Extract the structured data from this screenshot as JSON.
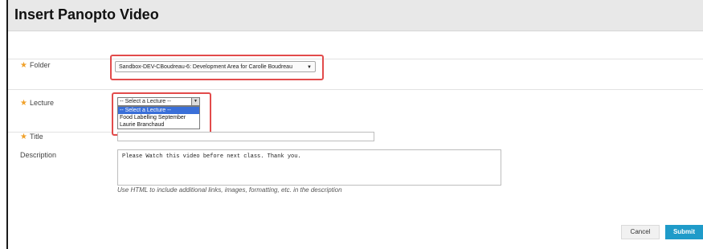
{
  "dialog": {
    "title": "Insert Panopto Video"
  },
  "form": {
    "folder": {
      "label": "Folder",
      "value": "Sandbox-DEV-CBoudreau-6: Development Area for Carolle Boudreau"
    },
    "lecture": {
      "label": "Lecture",
      "selected": "-- Select a Lecture --",
      "options": [
        "-- Select a Lecture --",
        "Food Labelling September",
        "Laurie Branchaud"
      ]
    },
    "title": {
      "label": "Title",
      "value": ""
    },
    "description": {
      "label": "Description",
      "value": "Please Watch this video before next class. Thank you.",
      "help": "Use HTML to include additional links, images, formatting, etc. in the description"
    }
  },
  "buttons": {
    "cancel": "Cancel",
    "submit": "Submit"
  },
  "colors": {
    "required_star": "#f0a12a",
    "highlight": "#e24b4b",
    "submit": "#1f9bc9",
    "selected_option": "#3a6fd8"
  }
}
